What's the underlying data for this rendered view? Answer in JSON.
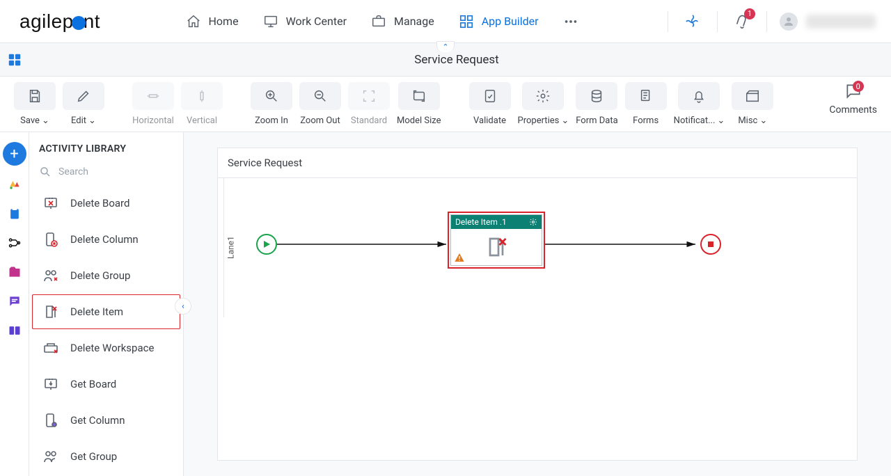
{
  "nav": {
    "items": [
      {
        "label": "Home"
      },
      {
        "label": "Work Center"
      },
      {
        "label": "Manage"
      },
      {
        "label": "App Builder"
      }
    ],
    "badge": "1"
  },
  "page": {
    "title": "Service Request"
  },
  "ribbon": {
    "save": "Save",
    "edit": "Edit",
    "horizontal": "Horizontal",
    "vertical": "Vertical",
    "zoom_in": "Zoom In",
    "zoom_out": "Zoom Out",
    "standard": "Standard",
    "model_size": "Model Size",
    "validate": "Validate",
    "properties": "Properties",
    "form_data": "Form Data",
    "forms": "Forms",
    "notifications": "Notificat...",
    "misc": "Misc",
    "comments": "Comments",
    "comments_count": "0"
  },
  "panel": {
    "title": "ACTIVITY LIBRARY",
    "search_placeholder": "Search",
    "items": [
      {
        "label": "Delete Board"
      },
      {
        "label": "Delete Column"
      },
      {
        "label": "Delete Group"
      },
      {
        "label": "Delete Item"
      },
      {
        "label": "Delete Workspace"
      },
      {
        "label": "Get Board"
      },
      {
        "label": "Get Column"
      },
      {
        "label": "Get Group"
      }
    ]
  },
  "canvas": {
    "title": "Service Request",
    "lane": "Lane1",
    "activity": {
      "title": "Delete Item .1"
    }
  }
}
